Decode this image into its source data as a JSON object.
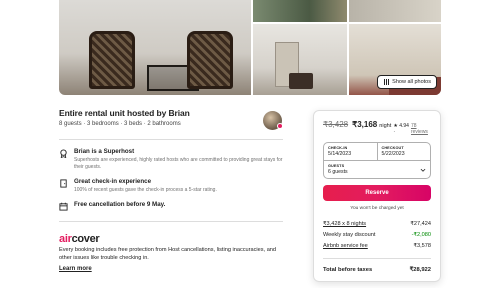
{
  "gallery": {
    "show_all_label": "Show all photos"
  },
  "listing": {
    "title": "Entire rental unit hosted by Brian",
    "subtitle": "8 guests · 3 bedrooms · 3 beds · 2 bathrooms"
  },
  "features": [
    {
      "icon": "medal-icon",
      "title": "Brian is a Superhost",
      "description": "Superhosts are experienced, highly rated hosts who are committed to providing great stays for their guests."
    },
    {
      "icon": "door-icon",
      "title": "Great check-in experience",
      "description": "100% of recent guests gave the check-in process a 5-star rating."
    },
    {
      "icon": "calendar-icon",
      "title": "Free cancellation before 9 May.",
      "description": ""
    }
  ],
  "aircover": {
    "brand_air": "air",
    "brand_cover": "cover",
    "description": "Every booking includes free protection from Host cancellations, listing inaccuracies, and other issues like trouble checking in.",
    "learn_more": "Learn more"
  },
  "booking": {
    "old_price": "₹3,428",
    "price": "₹3,168",
    "per": "night",
    "rating": "★ 4.94 ·",
    "reviews": "78 reviews",
    "checkin_label": "CHECK-IN",
    "checkin_value": "5/14/2023",
    "checkout_label": "CHECKOUT",
    "checkout_value": "5/22/2023",
    "guests_label": "GUESTS",
    "guests_value": "6 guests",
    "reserve_label": "Reserve",
    "charged_note": "You won't be charged yet",
    "lines": [
      {
        "label": "₹3,428 x 8 nights",
        "value": "₹27,424",
        "underline": true,
        "green": false
      },
      {
        "label": "Weekly stay discount",
        "value": "-₹2,080",
        "underline": false,
        "green": true
      },
      {
        "label": "Airbnb service fee",
        "value": "₹3,578",
        "underline": true,
        "green": false
      }
    ],
    "total_label": "Total before taxes",
    "total_value": "₹28,922"
  },
  "colors": {
    "brand": "#e31c5f",
    "discount": "#008a05"
  }
}
